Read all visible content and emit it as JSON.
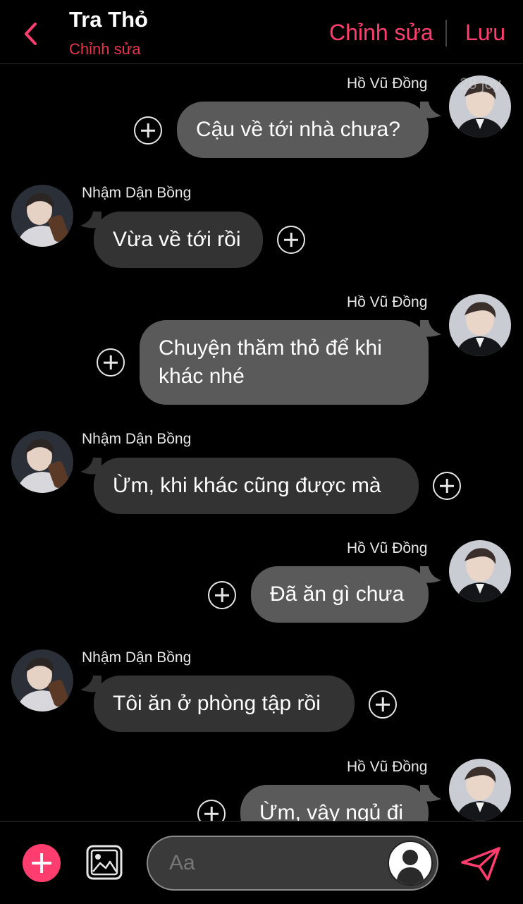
{
  "header": {
    "title": "Tra Thỏ",
    "subtitle": "Chỉnh sửa",
    "edit_label": "Chỉnh sửa",
    "save_label": "Lưu"
  },
  "watermark": "28 joy",
  "messages": [
    {
      "sender": "Hồ Vũ Đồng",
      "side": "out",
      "text": "Cậu về tới nhà chưa?"
    },
    {
      "sender": "Nhậm Dận Bồng",
      "side": "in",
      "text": "Vừa về tới rồi"
    },
    {
      "sender": "Hồ Vũ Đồng",
      "side": "out",
      "text": "Chuyện thăm thỏ để khi khác nhé"
    },
    {
      "sender": "Nhậm Dận Bồng",
      "side": "in",
      "text": "Ừm, khi khác cũng được mà"
    },
    {
      "sender": "Hồ Vũ Đồng",
      "side": "out",
      "text": "Đã ăn gì chưa"
    },
    {
      "sender": "Nhậm Dận Bồng",
      "side": "in",
      "text": "Tôi ăn ở phòng tập rồi"
    },
    {
      "sender": "Hồ Vũ Đồng",
      "side": "out",
      "text": "Ừm, vậy ngủ đi"
    }
  ],
  "composer": {
    "placeholder": "Aa"
  },
  "colors": {
    "accent": "#ff3d6e",
    "subtitle": "#e8334a",
    "outgoing_bubble": "#5a5a5a",
    "incoming_bubble": "#333333"
  }
}
